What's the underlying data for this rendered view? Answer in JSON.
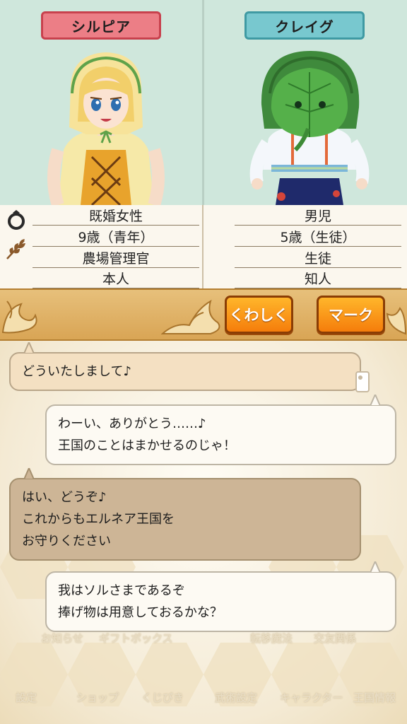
{
  "characters": {
    "left": {
      "name": "シルピア",
      "marital": "既婚女性",
      "age": "9歳（青年）",
      "job": "農場管理官",
      "relation": "本人"
    },
    "right": {
      "name": "クレイグ",
      "marital": "男児",
      "age": "5歳（生徒）",
      "job": "生徒",
      "relation": "知人"
    }
  },
  "icons": {
    "ring": "ring-icon",
    "leaf": "leaf-icon"
  },
  "actions": {
    "detail_label": "くわしく",
    "mark_label": "マーク"
  },
  "chat": {
    "messages": [
      {
        "side": "left",
        "lines": [
          "どういたしまして♪"
        ]
      },
      {
        "side": "right",
        "lines": [
          "わーい、ありがとう……♪",
          "王国のことはまかせるのじゃ！"
        ]
      },
      {
        "side": "left",
        "lines": [
          "はい、どうぞ♪",
          "これからもエルネア王国を",
          "お守りください"
        ]
      },
      {
        "side": "right",
        "lines": [
          "我はソルさまであるぞ",
          "捧げ物は用意しておるかな？"
        ]
      }
    ]
  },
  "menu": {
    "items": [
      "お知らせ",
      "ギフトボックス",
      "転移魔法",
      "交友関係",
      "設定",
      "ショップ",
      "くじびき",
      "武術設定",
      "キャラクター",
      "王国情報"
    ]
  },
  "colors": {
    "left_tag": "#ec7e86",
    "right_tag": "#78c8cf",
    "button": "#f57d0b",
    "band": "#d9a555"
  }
}
